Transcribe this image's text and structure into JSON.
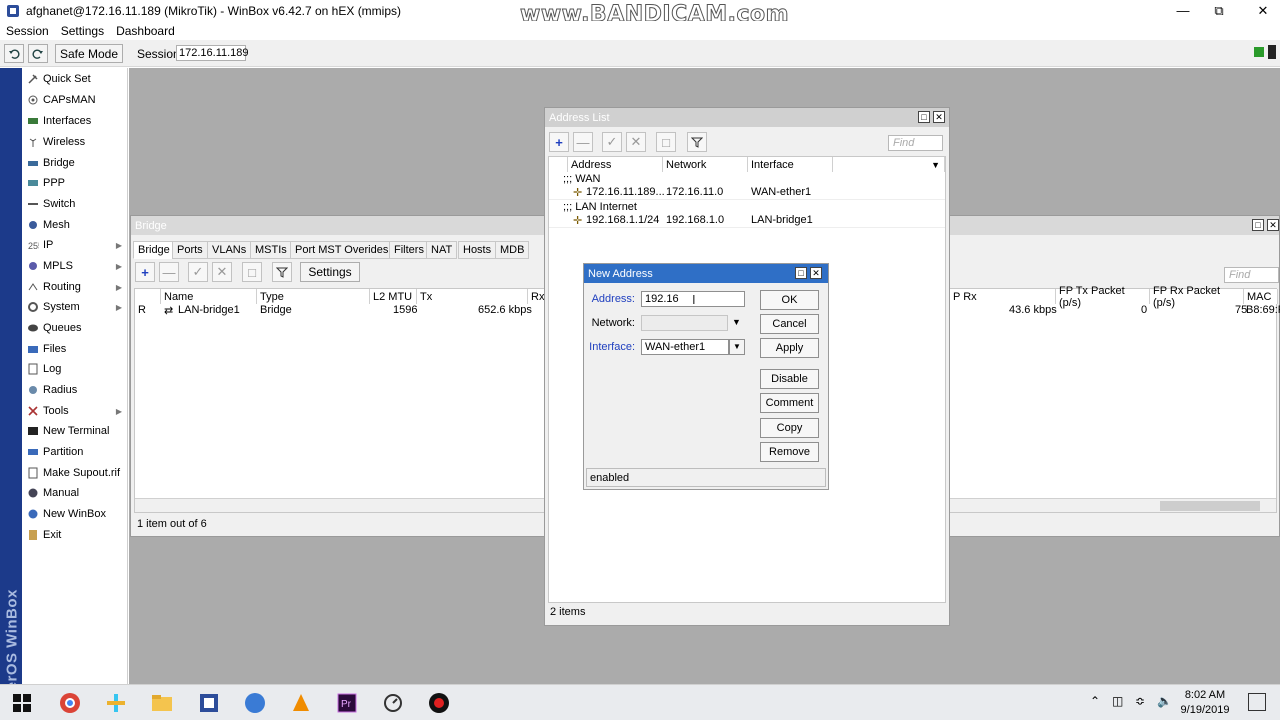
{
  "window": {
    "title": "afghanet@172.16.11.189 (MikroTik) - WinBox v6.42.7 on hEX (mmips)",
    "watermark": "www.BANDICAM.com"
  },
  "menu": [
    "Session",
    "Settings",
    "Dashboard"
  ],
  "toolbar": {
    "undo_icon": "undo-icon",
    "redo_icon": "redo-icon",
    "safe_mode": "Safe Mode",
    "session_label": "Session:",
    "session_value": "172.16.11.189"
  },
  "brand": "RouterOS WinBox",
  "sidebar": {
    "items": [
      {
        "label": "Quick Set",
        "icon": "quickset-icon",
        "arrow": false
      },
      {
        "label": "CAPsMAN",
        "icon": "capsman-icon",
        "arrow": false
      },
      {
        "label": "Interfaces",
        "icon": "interfaces-icon",
        "arrow": false
      },
      {
        "label": "Wireless",
        "icon": "wireless-icon",
        "arrow": false
      },
      {
        "label": "Bridge",
        "icon": "bridge-icon",
        "arrow": false
      },
      {
        "label": "PPP",
        "icon": "ppp-icon",
        "arrow": false
      },
      {
        "label": "Switch",
        "icon": "switch-icon",
        "arrow": false
      },
      {
        "label": "Mesh",
        "icon": "mesh-icon",
        "arrow": false
      },
      {
        "label": "IP",
        "icon": "ip-icon",
        "arrow": true
      },
      {
        "label": "MPLS",
        "icon": "mpls-icon",
        "arrow": true
      },
      {
        "label": "Routing",
        "icon": "routing-icon",
        "arrow": true
      },
      {
        "label": "System",
        "icon": "system-icon",
        "arrow": true
      },
      {
        "label": "Queues",
        "icon": "queues-icon",
        "arrow": false
      },
      {
        "label": "Files",
        "icon": "files-icon",
        "arrow": false
      },
      {
        "label": "Log",
        "icon": "log-icon",
        "arrow": false
      },
      {
        "label": "Radius",
        "icon": "radius-icon",
        "arrow": false
      },
      {
        "label": "Tools",
        "icon": "tools-icon",
        "arrow": true
      },
      {
        "label": "New Terminal",
        "icon": "terminal-icon",
        "arrow": false
      },
      {
        "label": "Partition",
        "icon": "partition-icon",
        "arrow": false
      },
      {
        "label": "Make Supout.rif",
        "icon": "supout-icon",
        "arrow": false
      },
      {
        "label": "Manual",
        "icon": "manual-icon",
        "arrow": false
      },
      {
        "label": "New WinBox",
        "icon": "winbox-icon",
        "arrow": false
      },
      {
        "label": "Exit",
        "icon": "exit-icon",
        "arrow": false
      }
    ]
  },
  "bridge_window": {
    "title": "Bridge",
    "tabs": [
      "Bridge",
      "Ports",
      "VLANs",
      "MSTIs",
      "Port MST Overides",
      "Filters",
      "NAT",
      "Hosts",
      "MDB"
    ],
    "settings_button": "Settings",
    "find_placeholder": "Find",
    "columns": [
      "Name",
      "Type",
      "L2 MTU",
      "Tx",
      "Rx"
    ],
    "right_columns": [
      "P Rx",
      "FP Tx Packet (p/s)",
      "FP Rx Packet (p/s)",
      "MAC"
    ],
    "row": {
      "flag": "R",
      "name": "LAN-bridge1",
      "type": "Bridge",
      "l2mtu": "1596",
      "tx": "652.6 kbps",
      "prx": "43.6 kbps",
      "fptx": "0",
      "fprx": "75",
      "mac": "B8:69:F"
    },
    "status": "1 item out of 6"
  },
  "address_list": {
    "title": "Address List",
    "find_placeholder": "Find",
    "columns": [
      "Address",
      "Network",
      "Interface"
    ],
    "groups": [
      {
        "comment": ";;; WAN",
        "address": "172.16.11.189...",
        "network": "172.16.11.0",
        "interface": "WAN-ether1"
      },
      {
        "comment": ";;; LAN Internet",
        "address": "192.168.1.1/24",
        "network": "192.168.1.0",
        "interface": "LAN-bridge1"
      }
    ],
    "status": "2 items"
  },
  "new_address": {
    "title": "New Address",
    "address_label": "Address:",
    "address_value": "192.16",
    "network_label": "Network:",
    "network_value": "",
    "interface_label": "Interface:",
    "interface_value": "WAN-ether1",
    "buttons": [
      "OK",
      "Cancel",
      "Apply",
      "Disable",
      "Comment",
      "Copy",
      "Remove"
    ],
    "status": "enabled"
  },
  "clock": {
    "time": "8:02 AM",
    "date": "9/19/2019"
  },
  "colors": {
    "accent": "#2f6fc6",
    "brand": "#1c3a8a",
    "label_blue": "#1f3fbf"
  }
}
